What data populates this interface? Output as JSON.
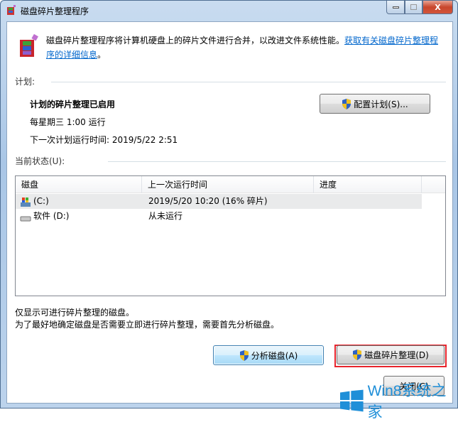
{
  "window": {
    "title": "磁盘碎片整理程序",
    "min_icon": "minimize-icon",
    "max_icon": "maximize-icon",
    "close_icon": "close-icon",
    "close_glyph": "X"
  },
  "description": {
    "text": "磁盘碎片整理程序将计算机硬盘上的碎片文件进行合并，以改进文件系统性能。",
    "link": "获取有关磁盘碎片整理程序的详细信息",
    "suffix": "。"
  },
  "schedule": {
    "section": "计划:",
    "status": "计划的碎片整理已启用",
    "frequency": "每星期三  1:00 运行",
    "next_run": "下一次计划运行时间: 2019/5/22 2:51",
    "configure_button": "配置计划(S)..."
  },
  "current": {
    "section": "当前状态(U):",
    "columns": [
      "磁盘",
      "上一次运行时间",
      "进度"
    ],
    "rows": [
      {
        "disk": "(C:)",
        "last_run": "2019/5/20 10:20 (16% 碎片)",
        "progress": "",
        "icon": "system-drive-icon"
      },
      {
        "disk": "软件 (D:)",
        "last_run": "从未运行",
        "progress": "",
        "icon": "drive-icon"
      }
    ]
  },
  "notes": [
    "仅显示可进行碎片整理的磁盘。",
    "为了最好地确定磁盘是否需要立即进行碎片整理，需要首先分析磁盘。"
  ],
  "buttons": {
    "analyze": "分析磁盘(A)",
    "defrag": "磁盘碎片整理(D)",
    "close": "关闭(C)"
  },
  "watermark": "Win8系统之家",
  "colors": {
    "link": "#0066cc",
    "highlight": "#e8242c",
    "watermark": "#1f8fd8"
  }
}
